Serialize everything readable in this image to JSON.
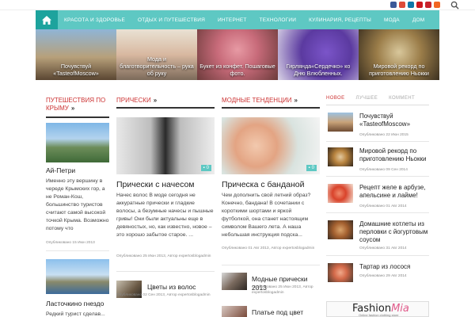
{
  "header": {
    "social_icons": [
      "facebook-icon",
      "google-plus-icon",
      "linkedin-icon",
      "youtube-icon",
      "pinterest-icon",
      "rss-icon"
    ],
    "accent": "#5ec8c3",
    "accent_dark": "#1da39d",
    "headline_red": "#cc3333"
  },
  "nav": {
    "items": [
      "КРАСОТА И ЗДОРОВЬЕ",
      "ОТДЫХ И ПУТЕШЕСТВИЯ",
      "ИНТЕРНЕТ",
      "ТЕХНОЛОГИИ",
      "КУЛИНАРИЯ, РЕЦЕПТЫ",
      "МОДА",
      "ДОМ"
    ]
  },
  "slider": [
    {
      "caption": "Почувствуй «TasteofMoscow»"
    },
    {
      "caption": "Мода и благотворительность – рука об руку"
    },
    {
      "caption": "Букет из конфет. Пошаговые фото."
    },
    {
      "caption": "Гирлянда«Сердечко» ко Дню Влюбленных."
    },
    {
      "caption": "Мировой рекорд по приготовлению Ньокки"
    }
  ],
  "col1": {
    "heading": "ПУТЕШЕСТВИЯ ПО КРЫМУ",
    "post1_title": "Ай-Петри",
    "post1_text": "Именно эту вершину в череде Крымских гор, а не Роман-Кош, большинство туристов считают самой высокой точкой Крыма. Возможно потому что",
    "post1_meta": "Опубликовано 15 Июн 2013",
    "post2_title": "Ласточкино гнездо",
    "post2_text": "Редкий турист сделав..."
  },
  "col2": {
    "heading": "ПРИЧЕСКИ",
    "badge": "0",
    "post_title": "Прически с начесом",
    "post_text": "Начес волос В моде сегодня не аккуратные прически и гладкие волосы, а безумные начесы и пышные гривы! Они были актуальны еще в девяностых, но, как известно, новое – это хорошо забытое старое. ...",
    "post_meta": "Опубликовано 25 Июн 2013, Автор expertosblogadmin",
    "small_title": "Цветы из волос",
    "small_meta": "Опубликовано 02 Сен 2013, Автор expertosblogadmin"
  },
  "col3": {
    "heading": "МОДНЫЕ ТЕНДЕНЦИИ",
    "badge": "0",
    "post_title": "Прическа с банданой",
    "post_text": "Чем дополнить свой летний образ? Конечно, бандана! В сочетании с короткими шортами и яркой футболкой, она станет настоящим символом Вашего лета. А наша небольшая инструкция подска...",
    "post_meta": "Опубликовано 01 Авг 2013, Автор expertosblogadmin",
    "small1_title": "Модные прически 2013",
    "small1_meta": "Опубликовано 25 Июн 2013, Автор expertosblogadmin",
    "small2_title": "Платье под цвет волос"
  },
  "sidebar": {
    "tabs": [
      "НОВОЕ",
      "ЛУЧШЕЕ",
      "КОММЕНТ"
    ],
    "items": [
      {
        "title": "Почувствуй «TasteofMoscow»",
        "meta": "Опубликовано 22 Июн 2015"
      },
      {
        "title": "Мировой рекорд по приготовлению Ньокки",
        "meta": "Опубликовано 09 Сен 2014"
      },
      {
        "title": "Рецепт желе в арбузе, апельсине и лайме!",
        "meta": "Опубликовано 01 Авг 2014"
      },
      {
        "title": "Домашние котлеты из перловки с йогуртовым соусом",
        "meta": "Опубликовано 31 Авг 2014"
      },
      {
        "title": "Тартар из лосося",
        "meta": "Опубликовано 29 Авг 2014"
      }
    ],
    "ad_logo_a": "Fashion",
    "ad_logo_b": "Mia",
    "ad_tagline": "Online fashion clothing store"
  }
}
